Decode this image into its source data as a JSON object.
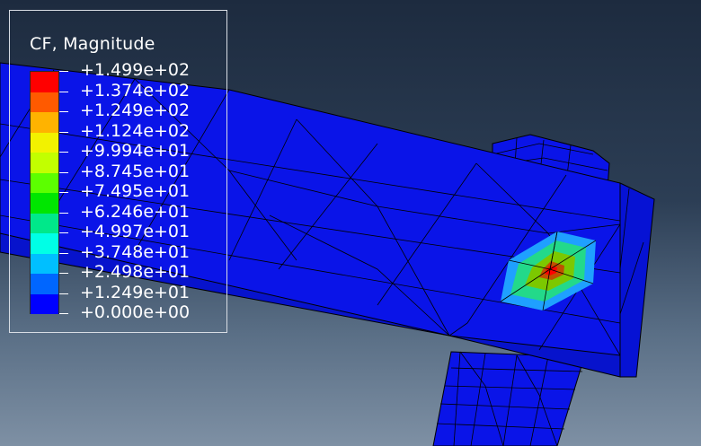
{
  "viewport": {
    "background_top": "#1d2b3f",
    "background_bottom": "#7e90a4"
  },
  "legend": {
    "title": "CF, Magnitude",
    "labels": [
      "+1.499e+02",
      "+1.374e+02",
      "+1.249e+02",
      "+1.124e+02",
      "+9.994e+01",
      "+8.745e+01",
      "+7.495e+01",
      "+6.246e+01",
      "+4.997e+01",
      "+3.748e+01",
      "+2.498e+01",
      "+1.249e+01",
      "+0.000e+00"
    ],
    "colors": [
      "#ff0000",
      "#ff5a00",
      "#ffb300",
      "#f2f200",
      "#c2ff00",
      "#5cff00",
      "#00e600",
      "#00e88a",
      "#00ffe6",
      "#00bfff",
      "#0066ff",
      "#0000ff"
    ]
  },
  "model": {
    "base_color": "#0a14e8",
    "mesh_line_color": "#000000",
    "hotspot_colors": [
      "#1fa0ff",
      "#23d98a",
      "#7cc800",
      "#ff0000"
    ]
  }
}
